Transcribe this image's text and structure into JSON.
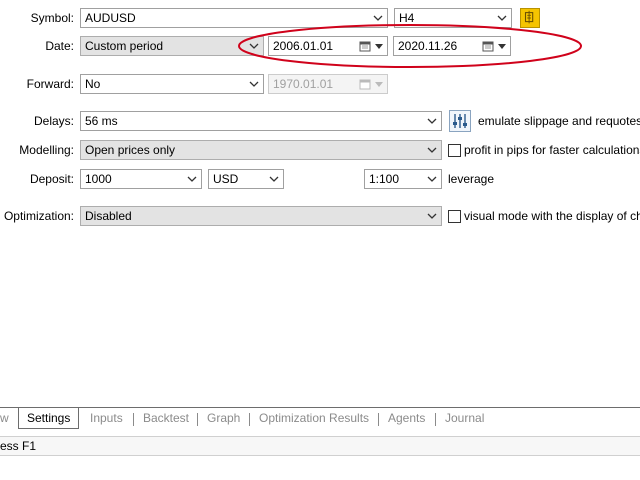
{
  "symbol": {
    "label": "Symbol:",
    "value": "AUDUSD",
    "timeframe": "H4"
  },
  "date": {
    "label": "Date:",
    "mode": "Custom period",
    "from": "2006.01.01",
    "to": "2020.11.26"
  },
  "forward": {
    "label": "Forward:",
    "value": "No",
    "date": "1970.01.01"
  },
  "delays": {
    "label": "Delays:",
    "value": "56 ms",
    "note": "emulate slippage and requotes dur"
  },
  "modelling": {
    "label": "Modelling:",
    "value": "Open prices only",
    "option": "profit in pips for faster calculations"
  },
  "deposit": {
    "label": "Deposit:",
    "amount": "1000",
    "currency": "USD",
    "leverage_value": "1:100",
    "leverage_label": "leverage"
  },
  "optimization": {
    "label": "Optimization:",
    "value": "Disabled",
    "option": "visual mode with the display of charts"
  },
  "tabs": [
    "w",
    "Settings",
    "Inputs",
    "Backtest",
    "Graph",
    "Optimization Results",
    "Agents",
    "Journal"
  ],
  "status": {
    "text": "ess F1"
  },
  "colors": {
    "annotation": "#d0021b",
    "accent_icon": "#f5c400"
  }
}
